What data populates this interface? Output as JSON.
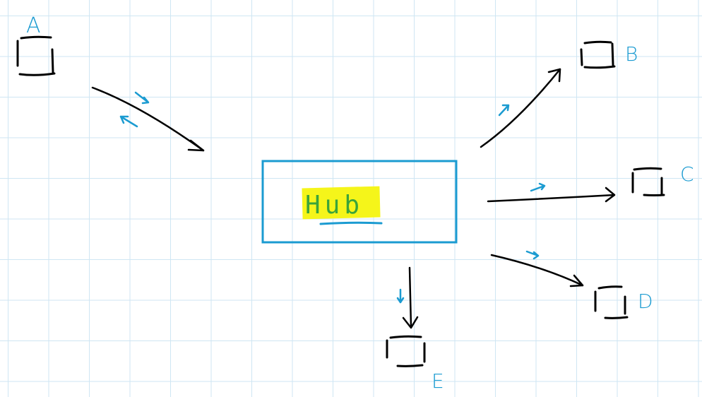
{
  "hub": {
    "label": "Hub"
  },
  "nodes": {
    "a": {
      "label": "A"
    },
    "b": {
      "label": "B"
    },
    "c": {
      "label": "C"
    },
    "d": {
      "label": "D"
    },
    "e": {
      "label": "E"
    }
  },
  "colors": {
    "ink": "#000000",
    "accent": "#1b9bd1",
    "highlight": "#f5f51a",
    "hub_text": "#3aa43a",
    "grid": "#cfe6f3"
  }
}
